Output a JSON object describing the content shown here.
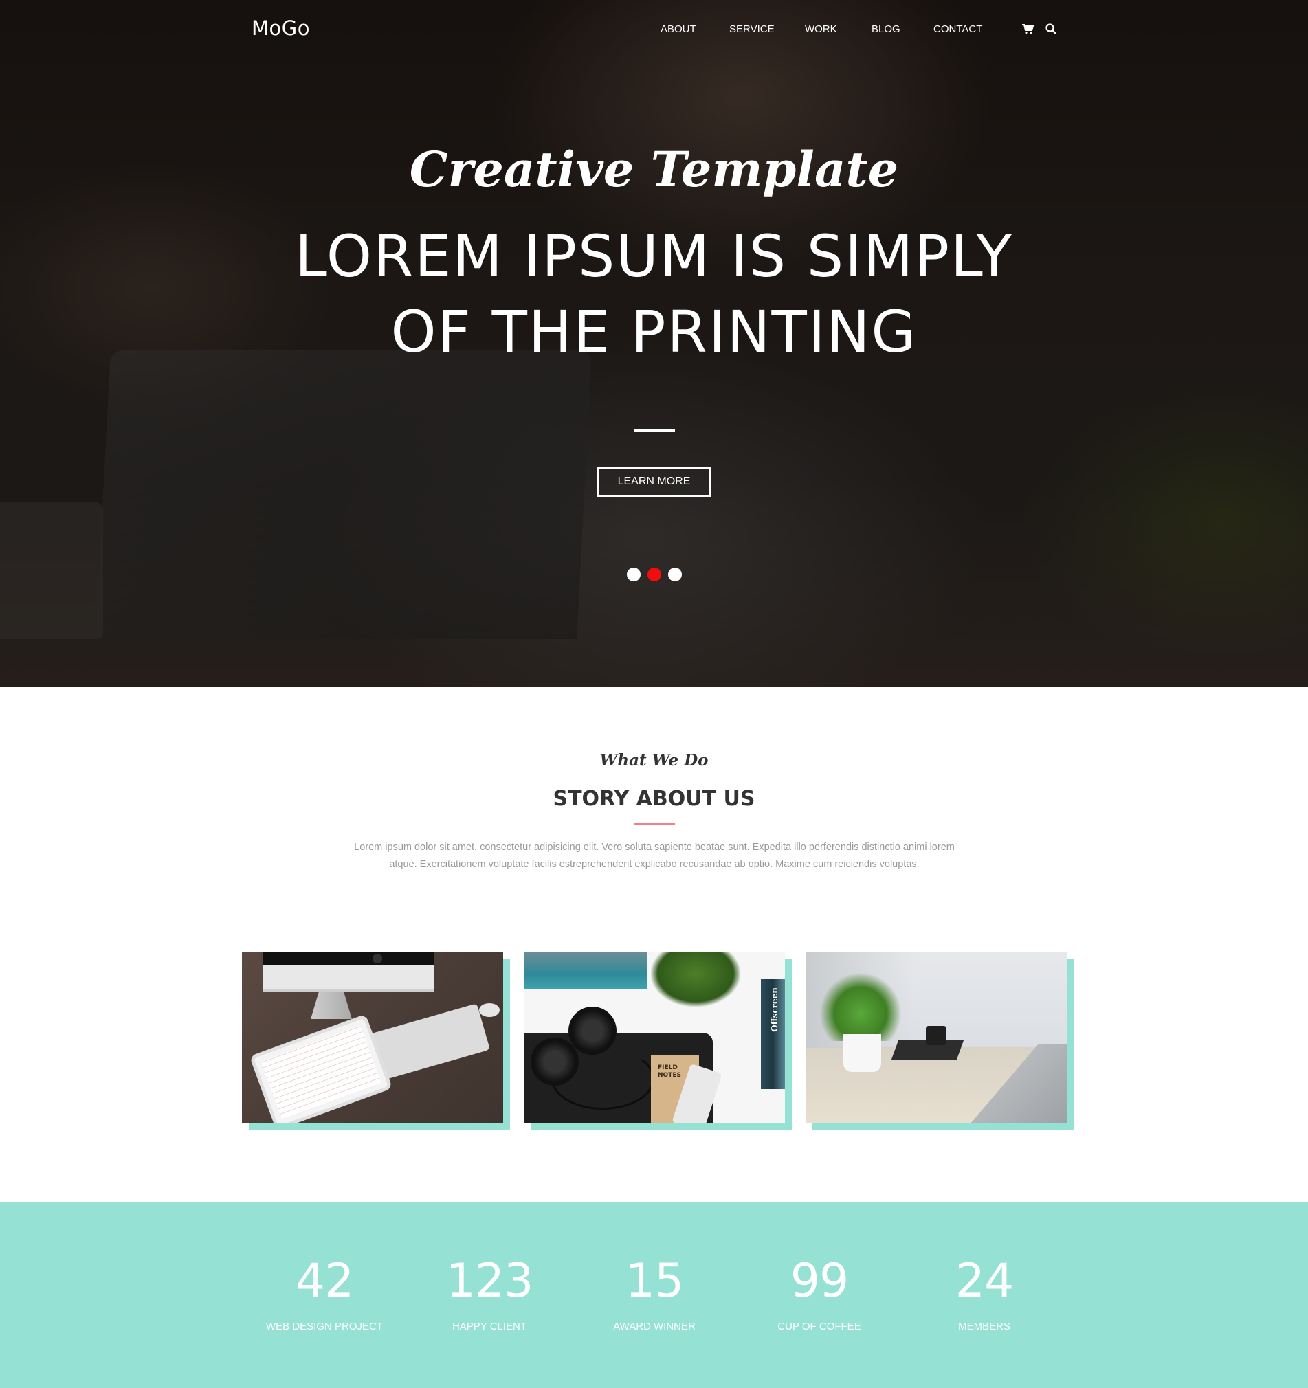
{
  "header": {
    "logo": "MoGo",
    "nav": [
      {
        "label": "ABOUT"
      },
      {
        "label": "SERVICE"
      },
      {
        "label": "WORK"
      },
      {
        "label": "BLOG"
      },
      {
        "label": "CONTACT"
      }
    ],
    "icons": [
      "cart-icon",
      "search-icon"
    ]
  },
  "hero": {
    "script_title": "Creative Template",
    "title_line1": "LOREM IPSUM IS SIMPLY",
    "title_line2": "OF THE PRINTING",
    "button_label": "LEARN MORE",
    "slides": 3,
    "active_slide": 2,
    "active_dot_color": "#f10d0d"
  },
  "about": {
    "script_title": "What We Do",
    "title": "STORY ABOUT US",
    "text_line1": "Lorem ipsum dolor sit amet, consectetur adipisicing elit. Vero soluta sapiente beatae sunt. Expedita illo perferendis distinctio animi lorem",
    "text_line2": "atque. Exercitationem voluptate facilis estreprehenderit explicabo recusandae ab optio. Maxime cum reiciendis voluptas.",
    "divider_color": "#f38181",
    "cards": [
      {
        "image": "desk-imac-ipad-keyboard"
      },
      {
        "image": "desk-headphones-notebook-phone",
        "notebook_text": "FIELD NOTES",
        "book_spine_text": "Offscreen"
      },
      {
        "image": "desk-plant-laptop-camera"
      }
    ],
    "card_shadow_color": "#95e1d3"
  },
  "stats": {
    "background": "#95e1d3",
    "items": [
      {
        "value": "42",
        "label": "WEB DESIGN PROJECT"
      },
      {
        "value": "123",
        "label": "HAPPY CLIENT"
      },
      {
        "value": "15",
        "label": "AWARD WINNER"
      },
      {
        "value": "99",
        "label": "CUP OF COFFEE"
      },
      {
        "value": "24",
        "label": "MEMBERS"
      }
    ]
  }
}
